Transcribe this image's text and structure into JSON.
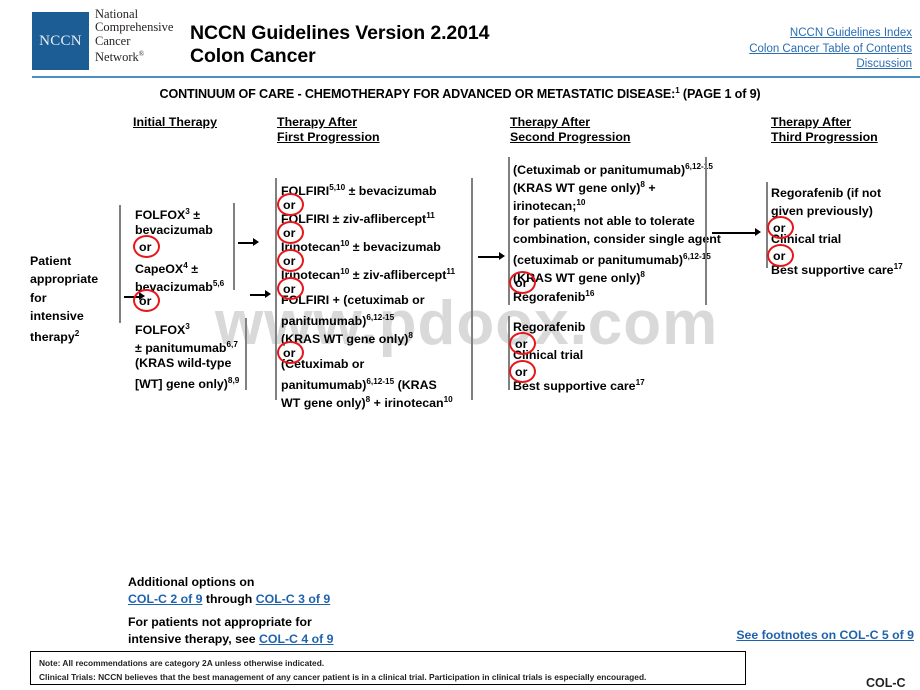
{
  "header": {
    "logo_text": "NCCN",
    "org_lines": [
      "National",
      "Comprehensive",
      "Cancer",
      "Network"
    ],
    "org_mark": "®",
    "title_line1": "NCCN Guidelines Version 2.2014",
    "title_line2": "Colon Cancer",
    "links": [
      "NCCN Guidelines Index",
      "Colon Cancer Table of Contents",
      "Discussion"
    ],
    "accent_color": "#1b5d94",
    "link_color": "#2a6db3"
  },
  "banner": {
    "text": "CONTINUUM OF CARE - CHEMOTHERAPY FOR ADVANCED OR METASTATIC DISEASE:",
    "superscript": "1",
    "suffix": " (PAGE 1 of 9)"
  },
  "watermark": {
    "text": "www.pdoox.com"
  },
  "columns": {
    "initial": {
      "line1": "Initial Therapy",
      "line2": ""
    },
    "first": {
      "line1": "Therapy After",
      "line2": "First Progression"
    },
    "second": {
      "line1": "Therapy After",
      "line2": "Second Progression"
    },
    "third": {
      "line1": "Therapy After",
      "line2": "Third Progression"
    }
  },
  "entry": {
    "lines": [
      "Patient",
      "appropriate",
      "for",
      "intensive",
      "therapy"
    ],
    "superscript": "2"
  },
  "or_label": "or",
  "initial_therapy": {
    "group_a": [
      {
        "text": "FOLFOX",
        "sup": "3",
        "tail": " ±"
      },
      {
        "text": "bevacizumab",
        "sup": "",
        "tail": ""
      },
      {
        "text": "CapeOX",
        "sup": "4",
        "tail": " ±"
      },
      {
        "text": "bevacizumab",
        "sup": "5,6",
        "tail": ""
      }
    ],
    "group_b": [
      {
        "text": "FOLFOX",
        "sup": "3",
        "tail": ""
      },
      {
        "text": " ± panitumumab",
        "sup": "6,7",
        "tail": ""
      },
      {
        "text": "(KRAS wild-type",
        "sup": "",
        "tail": ""
      },
      {
        "text": "[WT] gene only)",
        "sup": "8,9",
        "tail": ""
      }
    ]
  },
  "first_progression": {
    "options": [
      [
        {
          "text": "FOLFIRI",
          "sup": "5,10",
          "tail": " ± bevacizumab"
        }
      ],
      [
        {
          "text": "FOLFIRI ± ziv-aflibercept",
          "sup": "11",
          "tail": ""
        }
      ],
      [
        {
          "text": "Irinotecan",
          "sup": "10",
          "tail": " ± bevacizumab"
        }
      ],
      [
        {
          "text": "Irinotecan",
          "sup": "10",
          "tail": " ± ziv-aflibercept",
          "sup2": "11"
        }
      ],
      [
        {
          "text": "FOLFIRI + (cetuximab or",
          "sup": "",
          "tail": ""
        },
        {
          "text": "panitumumab)",
          "sup": "6,12-15",
          "tail": ""
        },
        {
          "text": "(KRAS WT gene only)",
          "sup": "8",
          "tail": ""
        }
      ],
      [
        {
          "text": "(Cetuximab or",
          "sup": "",
          "tail": ""
        },
        {
          "text": "panitumumab)",
          "sup": "6,12-15",
          "tail": " (KRAS"
        },
        {
          "text": "WT gene only)",
          "sup": "8",
          "tail": " + irinotecan",
          "sup2": "10"
        }
      ]
    ]
  },
  "second_progression": {
    "block1": [
      {
        "text": "(Cetuximab or panitumumab)",
        "sup": "6,12-15",
        "tail": ""
      },
      {
        "text": "(KRAS WT gene only)",
        "sup": "8",
        "tail": " +"
      },
      {
        "text": "irinotecan;",
        "sup": "10",
        "tail": ""
      },
      {
        "text": "for patients not able to tolerate",
        "sup": "",
        "tail": ""
      },
      {
        "text": "combination, consider single agent",
        "sup": "",
        "tail": ""
      },
      {
        "text": "(cetuximab or panitumumab)",
        "sup": "6,12-15",
        "tail": ""
      },
      {
        "text": "(KRAS WT gene only)",
        "sup": "8",
        "tail": ""
      }
    ],
    "block1_alt": [
      {
        "text": "Regorafenib",
        "sup": "16",
        "tail": ""
      }
    ],
    "block2": [
      [
        {
          "text": "Regorafenib",
          "sup": "",
          "tail": ""
        }
      ],
      [
        {
          "text": "Clinical trial",
          "sup": "",
          "tail": ""
        }
      ],
      [
        {
          "text": "Best supportive care",
          "sup": "17",
          "tail": ""
        }
      ]
    ]
  },
  "third_progression": {
    "options": [
      [
        {
          "text": "Regorafenib (if not",
          "sup": "",
          "tail": ""
        },
        {
          "text": "given previously)",
          "sup": "",
          "tail": ""
        }
      ],
      [
        {
          "text": "Clinical trial",
          "sup": "",
          "tail": ""
        }
      ],
      [
        {
          "text": "Best supportive care",
          "sup": "17",
          "tail": ""
        }
      ]
    ]
  },
  "additional": {
    "line1": "Additional options on",
    "link_a": "COL-C 2 of 9",
    "through": " through ",
    "link_b": "COL-C 3 of 9",
    "line3": "For patients not appropriate for",
    "line4_pre": "intensive therapy, see ",
    "link_c": "COL-C 4 of 9"
  },
  "footnote_link": "See footnotes on COL-C 5 of 9",
  "note_box": {
    "line1": "Note:  All recommendations are category 2A unless otherwise indicated.",
    "line2": "Clinical Trials: NCCN believes that the best management of any cancer patient is in a clinical trial.  Participation in clinical trials is especially encouraged."
  },
  "page_mark": "COL-C"
}
